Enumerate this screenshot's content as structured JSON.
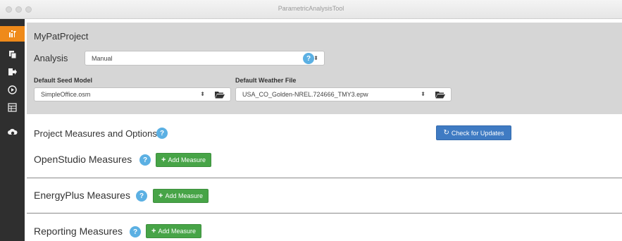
{
  "window": {
    "title": "ParametricAnalysisTool"
  },
  "sidebar": {
    "items": [
      {
        "icon": "analysis-icon",
        "active": true
      },
      {
        "icon": "copy-icon",
        "active": false
      },
      {
        "icon": "export-icon",
        "active": false
      },
      {
        "icon": "run-icon",
        "active": false
      },
      {
        "icon": "results-icon",
        "active": false
      },
      {
        "icon": "cloud-icon",
        "active": false
      }
    ]
  },
  "header": {
    "project_name": "MyPatProject",
    "analysis_label": "Analysis",
    "analysis_value": "Manual",
    "seed_model_label": "Default Seed Model",
    "seed_model_value": "SimpleOffice.osm",
    "weather_file_label": "Default Weather File",
    "weather_file_value": "USA_CO_Golden-NREL.724666_TMY3.epw"
  },
  "main": {
    "project_measures_title": "Project Measures and Options",
    "check_updates_label": "Check for Updates",
    "sections": [
      {
        "title": "OpenStudio Measures",
        "add_label": "Add Measure"
      },
      {
        "title": "EnergyPlus Measures",
        "add_label": "Add Measure"
      },
      {
        "title": "Reporting Measures",
        "add_label": "Add Measure"
      }
    ]
  },
  "colors": {
    "sidebar_bg": "#2f2f2f",
    "sidebar_active": "#ef8a1a",
    "header_bg": "#d6d6d6",
    "add_button": "#47a447",
    "update_button": "#3f7bc3",
    "info_icon": "#5bb0e3"
  }
}
